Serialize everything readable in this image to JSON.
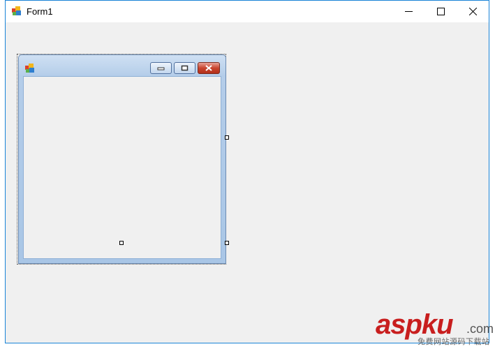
{
  "window": {
    "title": "Form1",
    "icon": "winforms-app-icon",
    "controls": {
      "minimize_icon": "minimize-icon",
      "maximize_icon": "maximize-icon",
      "close_icon": "close-icon"
    }
  },
  "designer": {
    "child_form": {
      "icon": "winforms-app-icon",
      "buttons": [
        "minimize-icon",
        "restore-icon",
        "close-icon"
      ],
      "close_color": "#c9452f"
    }
  },
  "watermark": {
    "brand": "aspku",
    "tld": ".com",
    "tagline": "免费网站源码下载站"
  },
  "colors": {
    "window_border": "#1883d7",
    "client_bg": "#f0f0f0",
    "child_title": "#b4cde9"
  }
}
